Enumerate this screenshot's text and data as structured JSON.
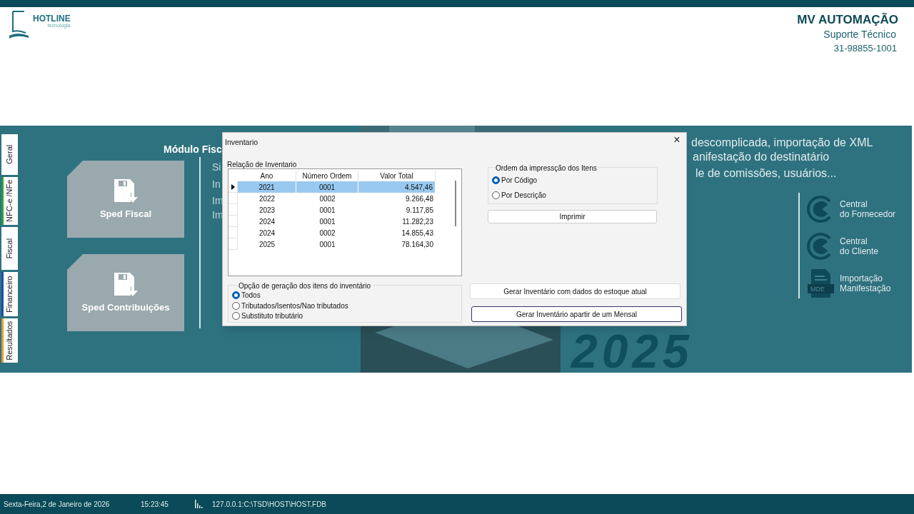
{
  "header": {
    "logo": "HOTLINE",
    "logo_sub": "tecnologia",
    "company": "MV AUTOMAÇÃO",
    "support": "Suporte Técnico",
    "phone": "31-98855-1001"
  },
  "side_tabs": [
    {
      "label": "Geral",
      "color": "#ffffff"
    },
    {
      "label": "NFC-e /NFe",
      "color": "#2e9e3e"
    },
    {
      "label": "Fiscal",
      "color": "#ffffff"
    },
    {
      "label": "Financeiro",
      "color": "#1f4fa8"
    },
    {
      "label": "Resultados",
      "color": "#e89a2c"
    }
  ],
  "cards": [
    {
      "label": "Sped Fiscal"
    },
    {
      "label": "Sped Contribuições"
    }
  ],
  "banner": {
    "heading": "Módulo Fisc",
    "left_fragments": [
      "Si",
      "In",
      "Im",
      "Im"
    ],
    "right_lines": [
      "descomplicada, importação de XML",
      "anifestação do destinatário",
      "le de comissões, usuários..."
    ],
    "year": "2025"
  },
  "links": [
    {
      "kind": "c",
      "line1": "Central",
      "line2": "do Fornecedor"
    },
    {
      "kind": "c",
      "line1": "Central",
      "line2": "do Cliente"
    },
    {
      "kind": "doc",
      "badge": "MDE",
      "line1": "Importação",
      "line2": "Manifestação"
    }
  ],
  "dialog": {
    "title": "Inventario",
    "close": "×",
    "list_label": "Relação de Inventario",
    "columns": [
      "Ano",
      "Número Ordem",
      "Valor Total"
    ],
    "rows": [
      {
        "cells": [
          "2021",
          "0001",
          "4.547,46"
        ],
        "selected": true
      },
      {
        "cells": [
          "2022",
          "0002",
          "9.266,48"
        ],
        "selected": false
      },
      {
        "cells": [
          "2023",
          "0001",
          "9.117,85"
        ],
        "selected": false
      },
      {
        "cells": [
          "2024",
          "0001",
          "11.282,23"
        ],
        "selected": false
      },
      {
        "cells": [
          "2024",
          "0002",
          "14.855,43"
        ],
        "selected": false
      },
      {
        "cells": [
          "2025",
          "0001",
          "78.164,30"
        ],
        "selected": false
      }
    ],
    "generation": {
      "label": "Opção de geração dos itens do inventário",
      "options": [
        {
          "label": "Todos",
          "selected": true
        },
        {
          "label": "Tributados/Isentos/Nao tributados",
          "selected": false
        },
        {
          "label": "Substituto tributário",
          "selected": false
        }
      ]
    },
    "order": {
      "label": "Ordem da impressção  dos Itens",
      "options": [
        {
          "label": "Por Código",
          "selected": true
        },
        {
          "label": "Por Descrição",
          "selected": false
        }
      ]
    },
    "print_button": "Imprimir",
    "buttons": [
      {
        "label": "Gerar Inventário com dados do estoque atual",
        "focused": false
      },
      {
        "label": "Gerar Inventário apartir de um Mensal",
        "focused": true
      }
    ]
  },
  "status_bar": {
    "date": "Sexta-Feira,2 de Janeiro de 2026",
    "time": "15:23:45",
    "database": "127.0.0.1:C:\\TSD\\HOST\\HOST.FDB"
  }
}
